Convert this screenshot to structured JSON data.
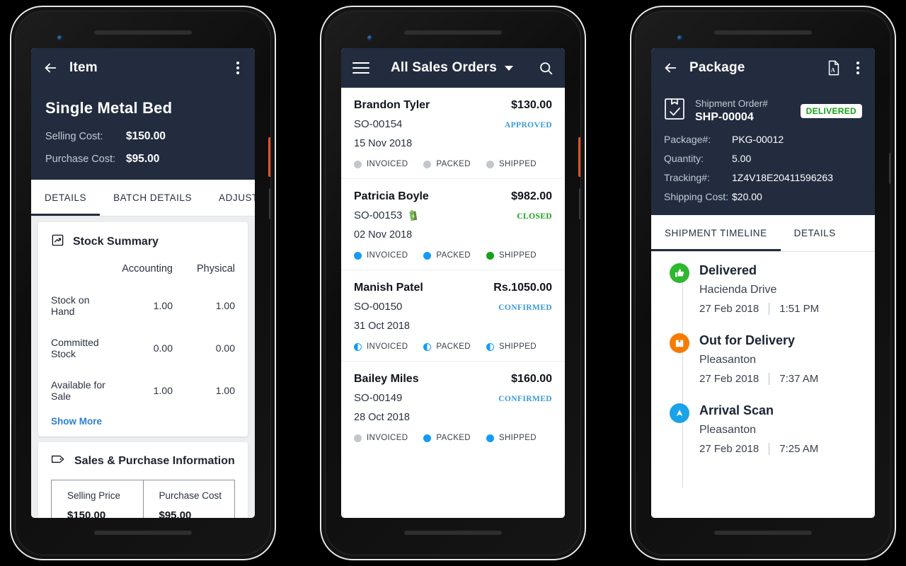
{
  "phone1": {
    "appbar": {
      "back_icon": "arrow-left-icon",
      "title": "Item",
      "menu_icon": "kebab-menu-icon"
    },
    "item_name": "Single Metal Bed",
    "fields": [
      {
        "label": "Selling Cost:",
        "value": "$150.00"
      },
      {
        "label": "Purchase Cost:",
        "value": "$95.00"
      }
    ],
    "tabs": [
      {
        "label": "DETAILS",
        "active": true
      },
      {
        "label": "BATCH DETAILS",
        "active": false
      },
      {
        "label": "ADJUSTMENT",
        "active": false
      }
    ],
    "stock_summary": {
      "icon": "stock-report-icon",
      "title": "Stock Summary",
      "columns": [
        "",
        "Accounting",
        "Physical"
      ],
      "rows": [
        {
          "label": "Stock on Hand",
          "accounting": "1.00",
          "physical": "1.00"
        },
        {
          "label": "Committed Stock",
          "accounting": "0.00",
          "physical": "0.00"
        },
        {
          "label": "Available for Sale",
          "accounting": "1.00",
          "physical": "1.00"
        }
      ],
      "show_more": "Show More"
    },
    "sales_purchase": {
      "icon": "price-tag-icon",
      "title": "Sales & Purchase Information",
      "selling_price_label": "Selling Price",
      "selling_price_value": "$150.00",
      "purchase_cost_label": "Purchase Cost",
      "purchase_cost_value": "$95.00"
    }
  },
  "phone2": {
    "appbar": {
      "menu_icon": "hamburger-icon",
      "title": "All Sales Orders",
      "dropdown_icon": "chevron-down-icon",
      "search_icon": "search-icon"
    },
    "orders": [
      {
        "customer": "Brandon Tyler",
        "amount": "$130.00",
        "number": "SO-00154",
        "status": "APPROVED",
        "status_color": "#3a9ad9",
        "date": "15 Nov 2018",
        "channel_icon": "",
        "flags": [
          {
            "label": "INVOICED",
            "state": "grey"
          },
          {
            "label": "PACKED",
            "state": "grey"
          },
          {
            "label": "SHIPPED",
            "state": "grey"
          }
        ]
      },
      {
        "customer": "Patricia Boyle",
        "amount": "$982.00",
        "number": "SO-00153",
        "status": "CLOSED",
        "status_color": "#17a018",
        "date": "02 Nov 2018",
        "channel_icon": "shopify-icon",
        "flags": [
          {
            "label": "INVOICED",
            "state": "blue"
          },
          {
            "label": "PACKED",
            "state": "blue"
          },
          {
            "label": "SHIPPED",
            "state": "green"
          }
        ]
      },
      {
        "customer": "Manish Patel",
        "amount": "Rs.1050.00",
        "number": "SO-00150",
        "status": "CONFIRMED",
        "status_color": "#3a9ad9",
        "date": "31 Oct 2018",
        "channel_icon": "",
        "flags": [
          {
            "label": "INVOICED",
            "state": "half"
          },
          {
            "label": "PACKED",
            "state": "half"
          },
          {
            "label": "SHIPPED",
            "state": "half"
          }
        ]
      },
      {
        "customer": "Bailey Miles",
        "amount": "$160.00",
        "number": "SO-00149",
        "status": "CONFIRMED",
        "status_color": "#3a9ad9",
        "date": "28 Oct 2018",
        "channel_icon": "",
        "flags": [
          {
            "label": "INVOICED",
            "state": "grey"
          },
          {
            "label": "PACKED",
            "state": "blue"
          },
          {
            "label": "SHIPPED",
            "state": "blue"
          }
        ]
      }
    ]
  },
  "phone3": {
    "appbar": {
      "back_icon": "arrow-left-icon",
      "title": "Package",
      "pdf_icon": "pdf-file-icon",
      "menu_icon": "kebab-menu-icon"
    },
    "shipment": {
      "icon": "package-check-icon",
      "order_label": "Shipment Order#",
      "order_number": "SHP-00004",
      "badge": "DELIVERED"
    },
    "fields": [
      {
        "label": "Package#:",
        "value": "PKG-00012"
      },
      {
        "label": "Quantity:",
        "value": "5.00"
      },
      {
        "label": "Tracking#:",
        "value": "1Z4V18E20411596263"
      },
      {
        "label": "Shipping Cost:",
        "value": "$20.00"
      }
    ],
    "tabs": [
      {
        "label": "SHIPMENT TIMELINE",
        "active": true
      },
      {
        "label": "DETAILS",
        "active": false
      }
    ],
    "timeline": [
      {
        "title": "Delivered",
        "place": "Hacienda Drive",
        "date": "27 Feb 2018",
        "time": "1:51 PM",
        "icon": "thumbs-up-icon",
        "color": "green"
      },
      {
        "title": "Out for Delivery",
        "place": "Pleasanton",
        "date": "27 Feb 2018",
        "time": "7:37 AM",
        "icon": "box-icon",
        "color": "orange"
      },
      {
        "title": "Arrival Scan",
        "place": "Pleasanton",
        "date": "27 Feb 2018",
        "time": "7:25 AM",
        "icon": "arrow-up-icon",
        "color": "blue"
      }
    ]
  },
  "theme": {
    "appbar_bg": "#222c3e",
    "accent_blue": "#2b7fd4",
    "status_green": "#17a018",
    "status_orange": "#f57c00",
    "status_blue": "#1aa3e8"
  }
}
